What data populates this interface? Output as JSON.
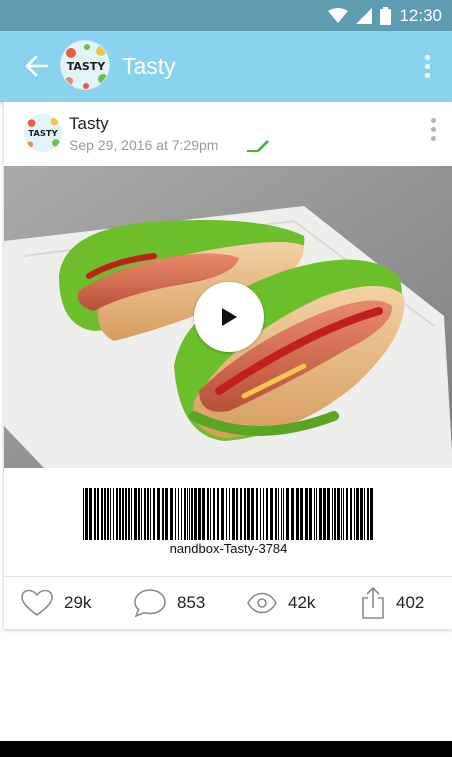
{
  "status_bar": {
    "time": "12:30",
    "icons": [
      "wifi-icon",
      "signal-icon",
      "battery-icon"
    ]
  },
  "toolbar": {
    "title": "Tasty",
    "avatar_text": "TASTY",
    "back_icon": "arrow-left-icon",
    "menu_icon": "more-vertical-icon"
  },
  "post": {
    "author": "Tasty",
    "avatar_text": "TASTY",
    "date": "Sep 29, 2016 at 7:29pm",
    "edited_icon": "pencil-icon",
    "media": {
      "type": "video",
      "play_icon": "play-icon"
    },
    "barcode_text": "nandbox-Tasty-3784",
    "stats": {
      "likes": "29k",
      "comments": "853",
      "views": "42k",
      "shares": "402"
    }
  },
  "colors": {
    "status_bar": "#5e9cb1",
    "toolbar": "#8ad3ee",
    "edited_accent": "#4caf50",
    "icon_gray": "#8a8a8a"
  }
}
